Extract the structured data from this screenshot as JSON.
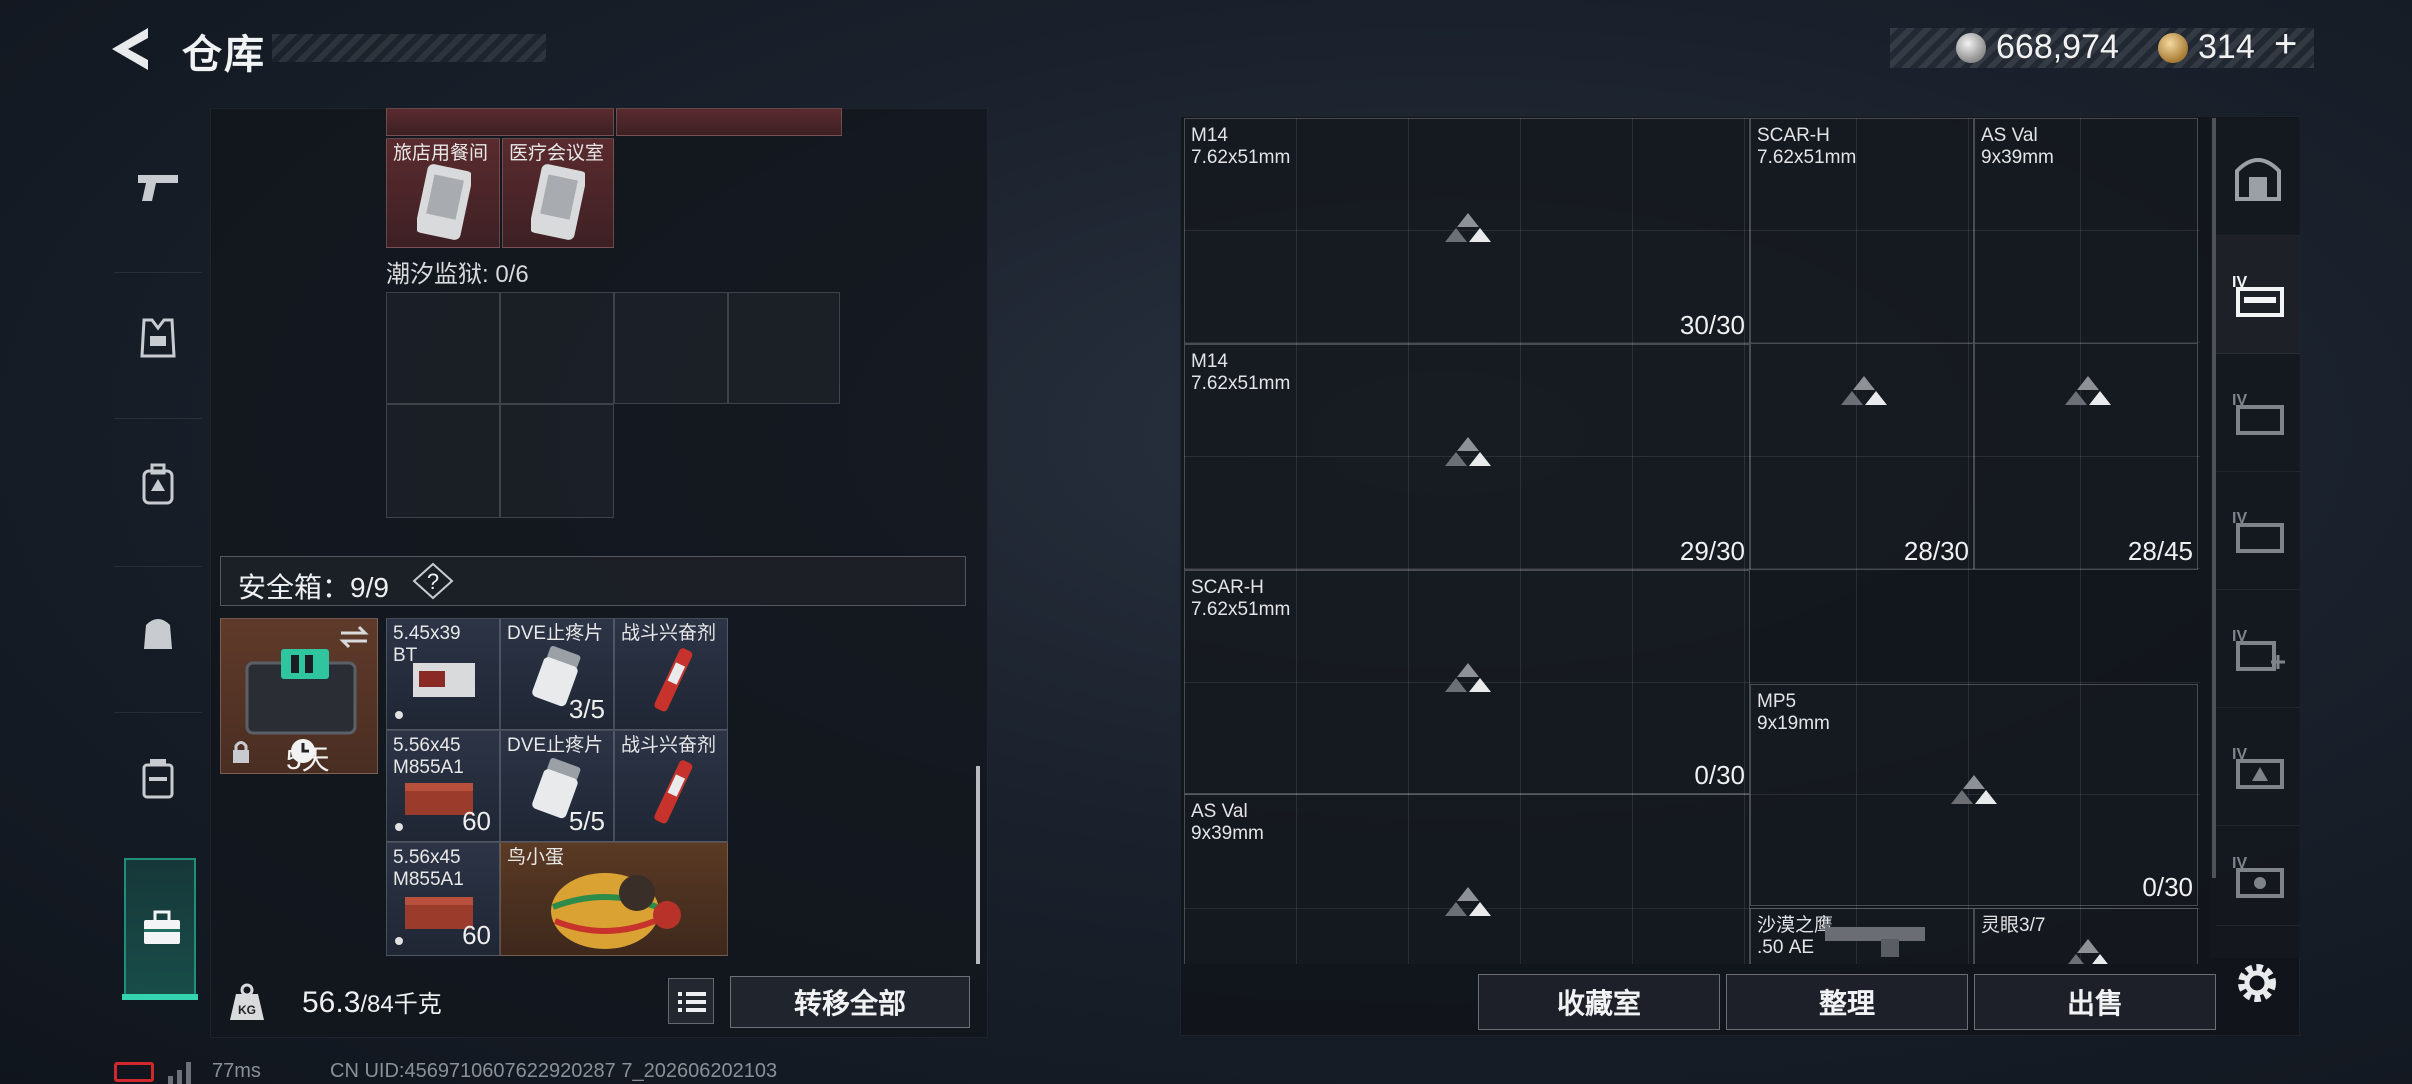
{
  "header": {
    "title": "仓库",
    "silver_amount": "668,974",
    "gold_amount": "314",
    "gold_add": "+"
  },
  "sidebar": {
    "tabs": [
      "pistol-icon",
      "vest-icon",
      "backpack-icon",
      "bag-icon",
      "case-icon",
      "toolbox-icon"
    ],
    "active_index": 5
  },
  "storage": {
    "keys": [
      {
        "label": "旅店用餐间"
      },
      {
        "label": "医疗会议室"
      }
    ],
    "prison_label": "潮汐监狱: 0/6",
    "safe_label": "安全箱：9/9",
    "safe_help": "?",
    "safe_days": "5天",
    "items": [
      {
        "label": "5.45x39\nBT",
        "count": ""
      },
      {
        "label": "DVE止疼片",
        "count": "3/5"
      },
      {
        "label": "战斗兴奋剂",
        "count": ""
      },
      {
        "label": "5.56x45\nM855A1",
        "count": "60"
      },
      {
        "label": "DVE止疼片",
        "count": "5/5"
      },
      {
        "label": "战斗兴奋剂",
        "count": ""
      },
      {
        "label": "5.56x45\nM855A1",
        "count": "60"
      },
      {
        "label": "鸟小蛋",
        "count": ""
      }
    ],
    "weight_value": "56.3",
    "weight_max": "/84千克",
    "transfer_all_label": "转移全部"
  },
  "warehouse": {
    "weapons": [
      {
        "name": "M14\n7.62x51mm",
        "count": "30/30"
      },
      {
        "name": "SCAR-H\n7.62x51mm",
        "count": ""
      },
      {
        "name": "AS Val\n9x39mm",
        "count": ""
      },
      {
        "name": "M14\n7.62x51mm",
        "count": "29/30"
      },
      {
        "name": "",
        "count": "28/30"
      },
      {
        "name": "",
        "count": "28/45"
      },
      {
        "name": "SCAR-H\n7.62x51mm",
        "count": "0/30"
      },
      {
        "name": "MP5\n9x19mm",
        "count": "0/30"
      },
      {
        "name": "AS Val\n9x39mm",
        "count": ""
      },
      {
        "name": "沙漠之鹰\n.50 AE",
        "count": ""
      },
      {
        "name": "灵眼3/7",
        "count": ""
      }
    ],
    "buttons": {
      "collection": "收藏室",
      "tidy": "整理",
      "sell": "出售"
    },
    "right_tabs": [
      "vault-icon",
      "storage-iv-1-icon",
      "storage-iv-2-icon",
      "storage-iv-3-icon",
      "storage-iv-add-icon",
      "storage-iv-4-icon",
      "storage-iv-5-icon"
    ]
  },
  "status_bar": {
    "ping": "77ms",
    "uid": "CN UID:4569710607622920287 7_202606202103"
  }
}
